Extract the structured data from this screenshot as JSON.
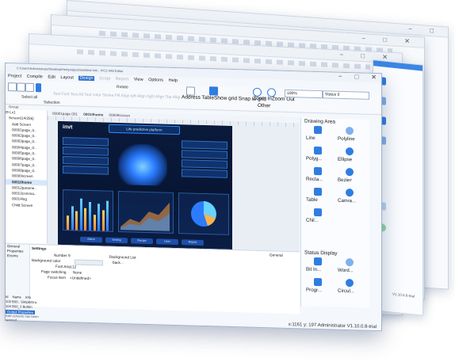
{
  "window": {
    "title": "C:\\Users\\Administrator\\Desktop\\Hmi\\projects\\test\\test.hmi - IVC3 HMI Editor",
    "controls": [
      "−",
      "□",
      "✕"
    ]
  },
  "menu": [
    "Project",
    "Compile",
    "Edit",
    "Layout",
    "Design",
    "Script",
    "Report",
    "View",
    "Options",
    "Help"
  ],
  "menu_active": "Design",
  "toolbar": {
    "row1_faded": "Text Font Text  Alt  Text color  Stroke  Fill  Align left  Align right  Align Top  Align Bottom  Center  Vertical  Horizontal",
    "mid_text": "Address TableShow grid  Snap to grid",
    "zoom_in_out": "Zoom InZoom Out",
    "zoom_value": "100%",
    "status_value": "Status 0",
    "selection_text": "Select all",
    "select_label": "Selection",
    "rotate_label": "Rotate",
    "other_label": "Other"
  },
  "group_label": "Group",
  "tree": {
    "items": [
      "Screen(14/256)",
      "Add Screen",
      "00001page_0..",
      "00002page_0..",
      "00003page_0..",
      "00004page_0..",
      "00005page_0..",
      "00006page_0..",
      "00007page_0..",
      "00008page_0..",
      "00009screen",
      "00010home",
      "00012parame..",
      "00013comma..",
      "00014log",
      "Child Screen"
    ],
    "selected": "00010home",
    "root": "Lv1"
  },
  "tabs": [
    "00001page 001",
    "00010home",
    "00009screen"
  ],
  "screen": {
    "logo": "invt",
    "title": "Life predictive platform",
    "buttons": [
      "Alarm",
      "Setting",
      "Recipe",
      "User",
      "Report"
    ]
  },
  "drawing": {
    "header": "Drawing Area",
    "items": [
      "Line",
      "Polyline",
      "Polyg...",
      "Ellipse",
      "Recta...",
      "Bezier",
      "Table",
      "Canva...",
      "Chil..."
    ]
  },
  "status_display": {
    "header": "Status Display",
    "items": [
      "Bit In...",
      "Word...",
      "Progr...",
      "Circul..."
    ]
  },
  "props": {
    "list": [
      "General",
      "Properties",
      "Events"
    ],
    "section": "Settings",
    "number": "Number 9",
    "bg_color": "Background color",
    "font": "Font Arial,12",
    "page_switching": "Page switching",
    "page_switching_value": "None",
    "focus_item": "Focus item",
    "focus_item_value": "<Undefined>",
    "bg_list": "Background List",
    "bg_item": "back...",
    "general_tab": "General"
  },
  "grid_table": {
    "header": [
      "Id",
      "Name",
      "Info"
    ],
    "rows": [
      [
        "103",
        "B00..",
        "SimpleGra.."
      ],
      [
        "104",
        "B00_2",
        "Button"
      ]
    ]
  },
  "footer": {
    "tab": "Output  Properties",
    "message": "Add screens has been opened"
  },
  "status_bar": "x:1161 y: 197 Administrator V1.10.0.8-trial",
  "back_sliver_version": "V1.10.0.6-trial",
  "colors": {
    "accent": "#2b6fc9",
    "screen_bg": "#0a1a3b",
    "chart_orange": "#ff8a3d"
  }
}
